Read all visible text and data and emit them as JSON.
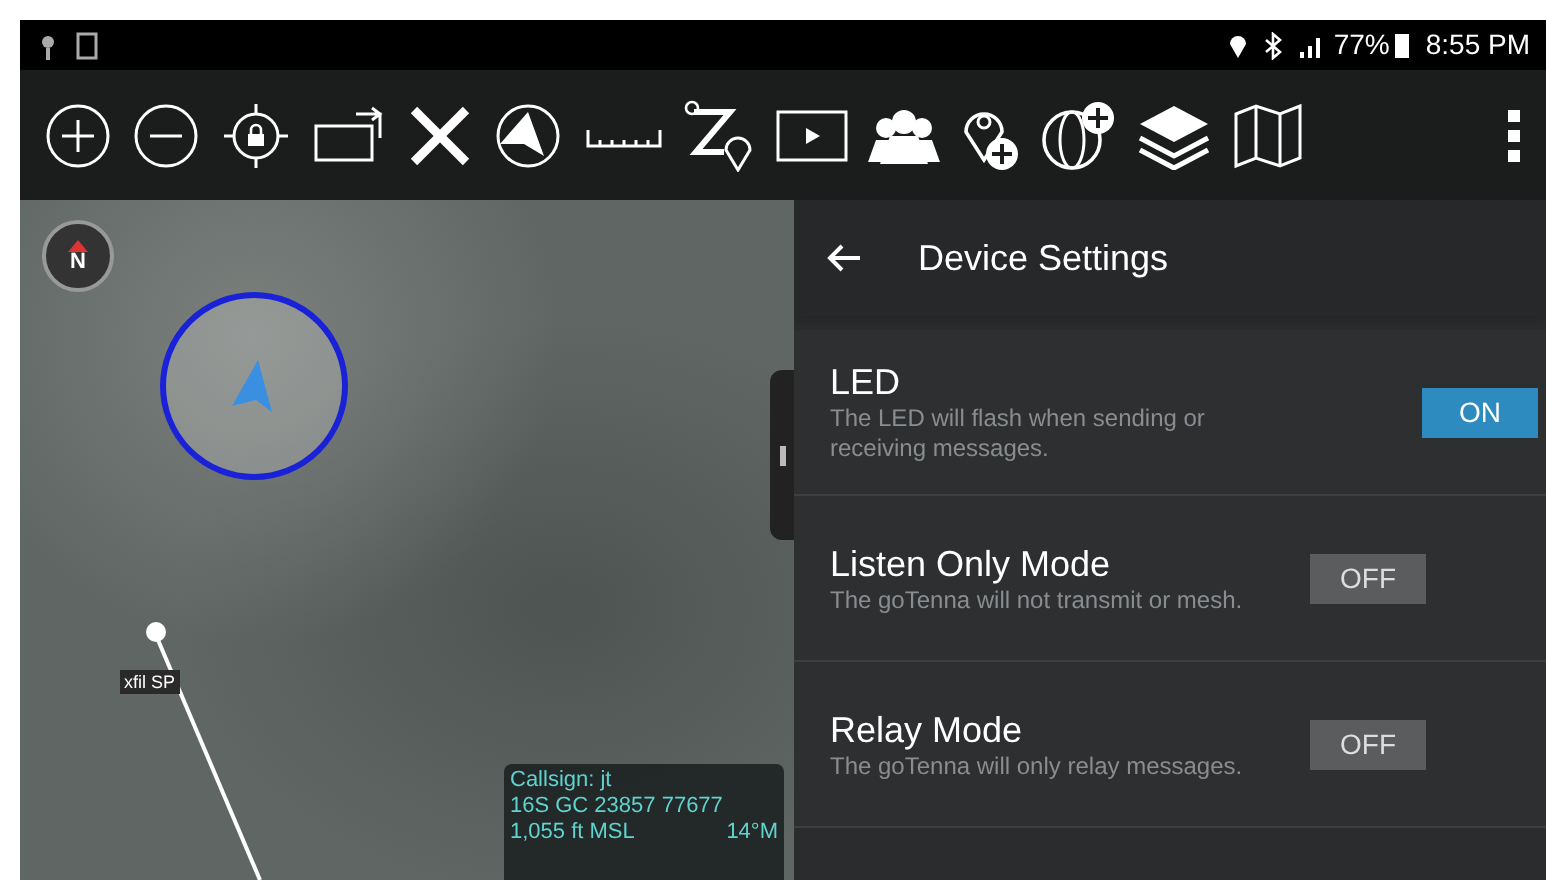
{
  "status_bar": {
    "battery": "77%",
    "time": "8:55 PM"
  },
  "map": {
    "compass": "N",
    "waypoint_label": "xfil SP",
    "info": {
      "callsign": "Callsign: jt",
      "rows": [
        [
          "16S GC 23857 77677",
          ""
        ],
        [
          "1,055 ft MSL",
          "14°M"
        ]
      ]
    }
  },
  "panel": {
    "title": "Device Settings",
    "settings": [
      {
        "title": "LED",
        "description": "The LED will flash when sending or receiving messages.",
        "toggle_label": "ON",
        "on": true
      },
      {
        "title": "Listen Only Mode",
        "description": "The goTenna will not transmit or mesh.",
        "toggle_label": "OFF",
        "on": false
      },
      {
        "title": "Relay Mode",
        "description": "The goTenna will only relay messages.",
        "toggle_label": "OFF",
        "on": false
      }
    ]
  }
}
